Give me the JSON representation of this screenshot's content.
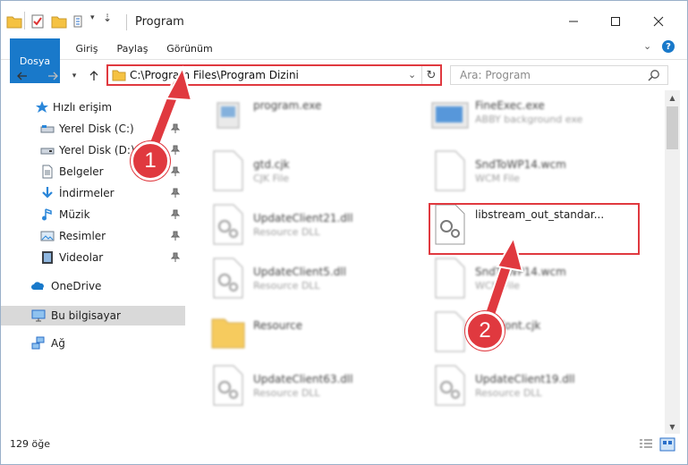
{
  "window": {
    "title": "Program"
  },
  "ribbon": {
    "tabs": [
      "Dosya",
      "Giriş",
      "Paylaş",
      "Görünüm"
    ]
  },
  "nav": {
    "address": "C:\\Program Files\\Program Dizini",
    "search_placeholder": "Ara: Program"
  },
  "sidebar": {
    "items": [
      {
        "label": "Hızlı erişim",
        "icon": "star-icon"
      },
      {
        "label": "Yerel Disk (C:)",
        "icon": "drive-icon",
        "pinned": true
      },
      {
        "label": "Yerel Disk (D:)",
        "icon": "drive-icon",
        "pinned": true
      },
      {
        "label": "Belgeler",
        "icon": "documents-icon",
        "pinned": true
      },
      {
        "label": "İndirmeler",
        "icon": "downloads-icon",
        "pinned": true
      },
      {
        "label": "Müzik",
        "icon": "music-icon",
        "pinned": true
      },
      {
        "label": "Resimler",
        "icon": "pictures-icon",
        "pinned": true
      },
      {
        "label": "Videolar",
        "icon": "videos-icon",
        "pinned": true
      },
      {
        "label": "OneDrive",
        "icon": "onedrive-icon"
      },
      {
        "label": "Bu bilgisayar",
        "icon": "computer-icon",
        "selected": true
      },
      {
        "label": "Ağ",
        "icon": "network-icon"
      }
    ]
  },
  "files": [
    {
      "name": "program.exe",
      "type": ""
    },
    {
      "name": "FineExec.exe",
      "type": "ABBY background exe"
    },
    {
      "name": "gtd.cjk",
      "type": "CJK File"
    },
    {
      "name": "SndToWP14.wcm",
      "type": "WCM File"
    },
    {
      "name": "UpdateClient21.dll",
      "type": "Resource DLL"
    },
    {
      "name": "libstream_out_standar...",
      "type": ""
    },
    {
      "name": "UpdateClient5.dll",
      "type": "Resource DLL"
    },
    {
      "name": "SndToWP14.wcm",
      "type": "WCM File"
    },
    {
      "name": "Resource",
      "type": ""
    },
    {
      "name": "BoldFont.cjk",
      "type": ""
    },
    {
      "name": "UpdateClient63.dll",
      "type": "Resource DLL"
    },
    {
      "name": "UpdateClient19.dll",
      "type": "Resource DLL"
    }
  ],
  "status": {
    "count": "129 öğe"
  },
  "annotations": {
    "badge1": "1",
    "badge2": "2"
  },
  "colors": {
    "accent": "#1979ca",
    "highlight": "#e0393f",
    "selected_bg": "#d9d9d9"
  }
}
